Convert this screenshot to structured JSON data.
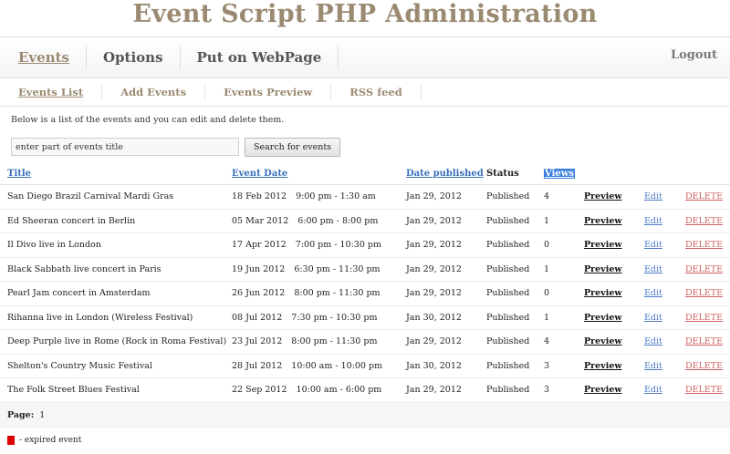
{
  "app": {
    "title": "Event Script PHP Administration"
  },
  "main_nav": {
    "items": [
      {
        "label": "Events",
        "active": true
      },
      {
        "label": "Options",
        "active": false
      },
      {
        "label": "Put on WebPage",
        "active": false
      }
    ],
    "logout": "Logout"
  },
  "sub_nav": {
    "items": [
      {
        "label": "Events List",
        "active": true
      },
      {
        "label": "Add Events",
        "active": false
      },
      {
        "label": "Events Preview",
        "active": false
      },
      {
        "label": "RSS feed",
        "active": false
      }
    ]
  },
  "intro_text": "Below is a list of the events and you can edit and delete them.",
  "search": {
    "value": "enter part of events title",
    "button": "Search for events"
  },
  "table": {
    "headers": {
      "title": "Title",
      "event_date": "Event Date",
      "date_published": "Date published",
      "status": "Status",
      "views": "Views"
    },
    "actions": {
      "preview": "Preview",
      "edit": "Edit",
      "delete": "DELETE"
    },
    "rows": [
      {
        "title": "San Diego Brazil Carnival Mardi Gras",
        "date": "18 Feb 2012",
        "time": "9:00 pm - 1:30 am",
        "published": "Jan 29, 2012",
        "status": "Published",
        "views": "4"
      },
      {
        "title": "Ed Sheeran concert in Berlin",
        "date": "05 Mar 2012",
        "time": "6:00 pm - 8:00 pm",
        "published": "Jan 29, 2012",
        "status": "Published",
        "views": "1"
      },
      {
        "title": "Il Divo live in London",
        "date": "17 Apr 2012",
        "time": "7:00 pm - 10:30 pm",
        "published": "Jan 29, 2012",
        "status": "Published",
        "views": "0"
      },
      {
        "title": "Black Sabbath live concert in Paris",
        "date": "19 Jun 2012",
        "time": "6:30 pm - 11:30 pm",
        "published": "Jan 29, 2012",
        "status": "Published",
        "views": "1"
      },
      {
        "title": "Pearl Jam concert in Amsterdam",
        "date": "26 Jun 2012",
        "time": "8:00 pm - 11:30 pm",
        "published": "Jan 29, 2012",
        "status": "Published",
        "views": "0"
      },
      {
        "title": "Rihanna live in London (Wireless Festival)",
        "date": "08 Jul 2012",
        "time": "7:30 pm - 10:30 pm",
        "published": "Jan 30, 2012",
        "status": "Published",
        "views": "1"
      },
      {
        "title": "Deep Purple live in Rome (Rock in Roma Festival)",
        "date": "23 Jul 2012",
        "time": "8:00 pm - 11:30 pm",
        "published": "Jan 29, 2012",
        "status": "Published",
        "views": "4"
      },
      {
        "title": "Shelton's Country Music Festival",
        "date": "28 Jul 2012",
        "time": "10:00 am - 10:00 pm",
        "published": "Jan 30, 2012",
        "status": "Published",
        "views": "3"
      },
      {
        "title": "The Folk Street Blues Festival",
        "date": "22 Sep 2012",
        "time": "10:00 am - 6:00 pm",
        "published": "Jan 29, 2012",
        "status": "Published",
        "views": "3"
      }
    ]
  },
  "pager": {
    "label": "Page:",
    "current": "1"
  },
  "legend": {
    "text": "- expired event",
    "color": "#dd0000"
  }
}
